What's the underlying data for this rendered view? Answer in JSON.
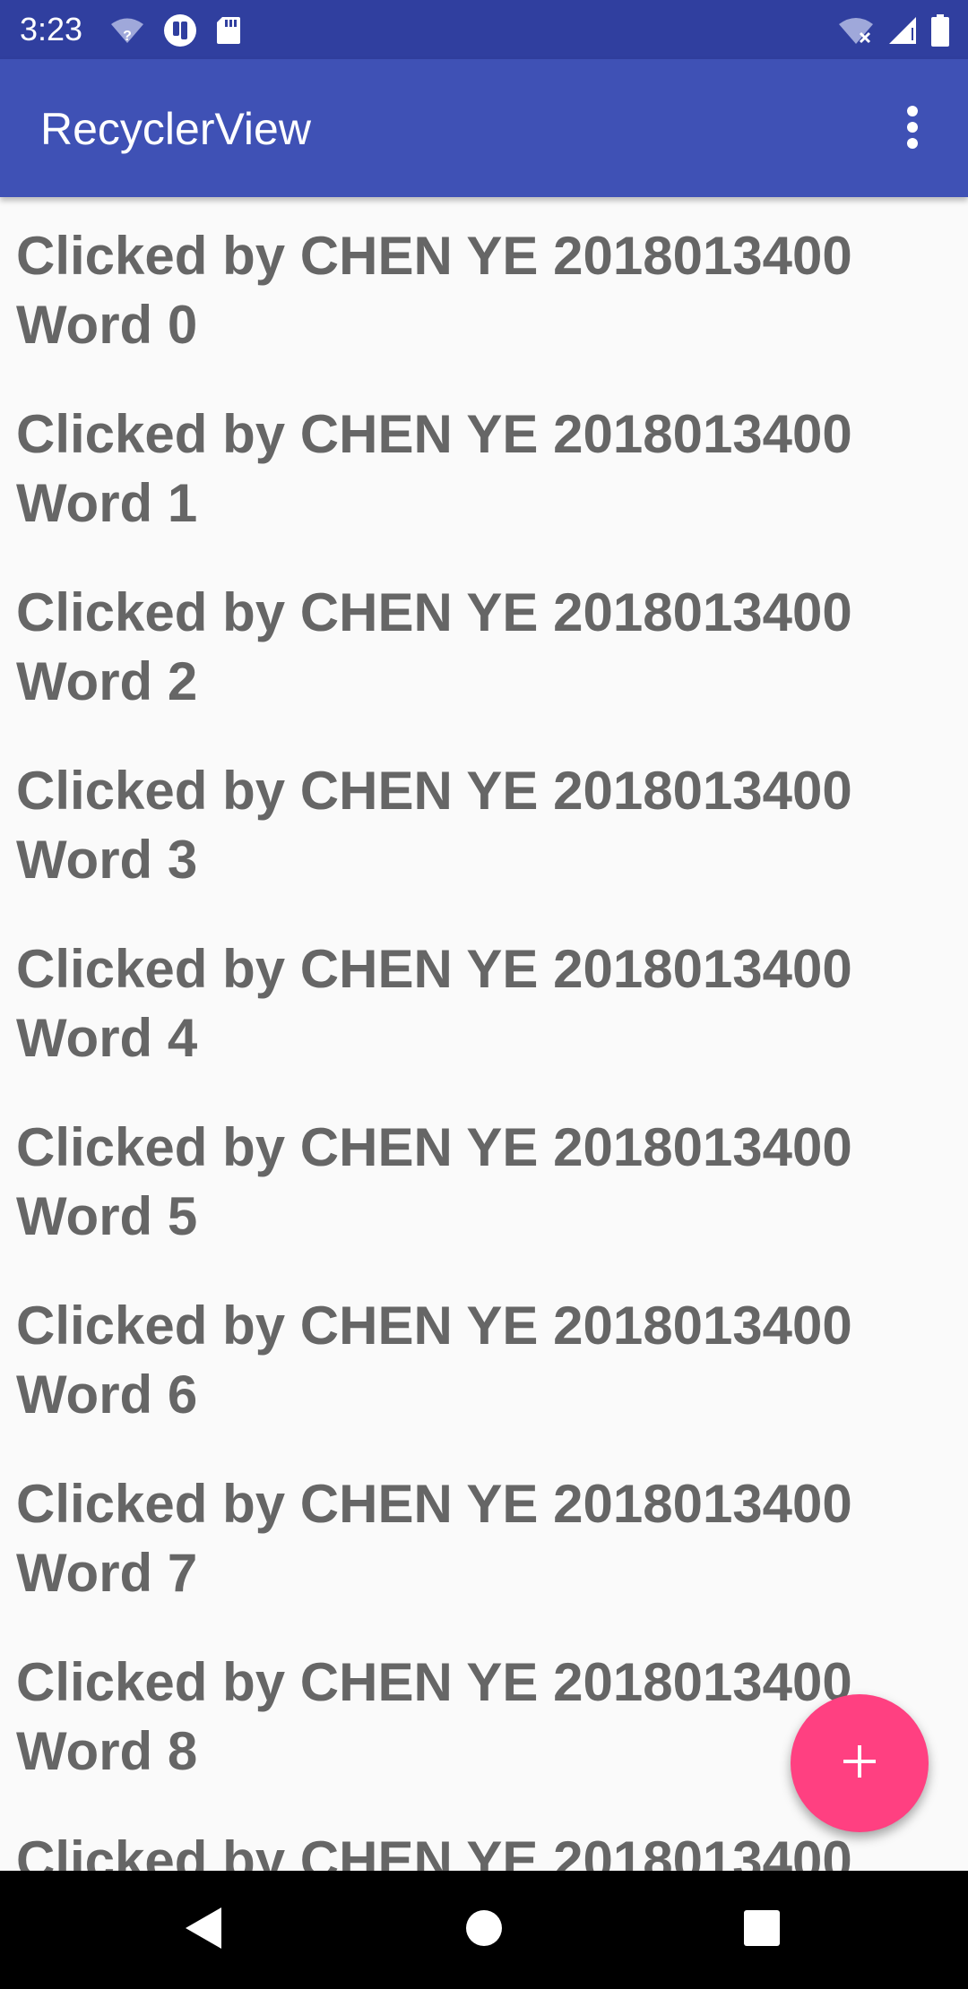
{
  "status_bar": {
    "time": "3:23",
    "icons_left": [
      "wifi-unknown-icon",
      "app-notification-icon",
      "sd-card-icon"
    ],
    "icons_right": [
      "wifi-off-icon",
      "cell-signal-icon",
      "battery-icon"
    ]
  },
  "app_bar": {
    "title": "RecyclerView",
    "overflow_icon": "more-vert-icon"
  },
  "list": {
    "items": [
      "Clicked by CHEN YE 2018013400\nWord 0",
      "Clicked by CHEN YE 2018013400\nWord 1",
      "Clicked by CHEN YE 2018013400\nWord 2",
      "Clicked by CHEN YE 2018013400\nWord 3",
      "Clicked by CHEN YE 2018013400\nWord 4",
      "Clicked by CHEN YE 2018013400\nWord 5",
      "Clicked by CHEN YE 2018013400\nWord 6",
      "Clicked by CHEN YE 2018013400\nWord 7",
      "Clicked by CHEN YE 2018013400\nWord 8",
      "Clicked by CHEN YE 2018013400"
    ]
  },
  "fab": {
    "icon": "plus-icon"
  },
  "nav_bar": {
    "buttons": [
      "back-icon",
      "home-icon",
      "recents-icon"
    ]
  },
  "colors": {
    "status_bar": "#303f9f",
    "app_bar": "#3f51b5",
    "accent": "#ff4081",
    "list_text": "#666666",
    "background": "#fafafa"
  }
}
